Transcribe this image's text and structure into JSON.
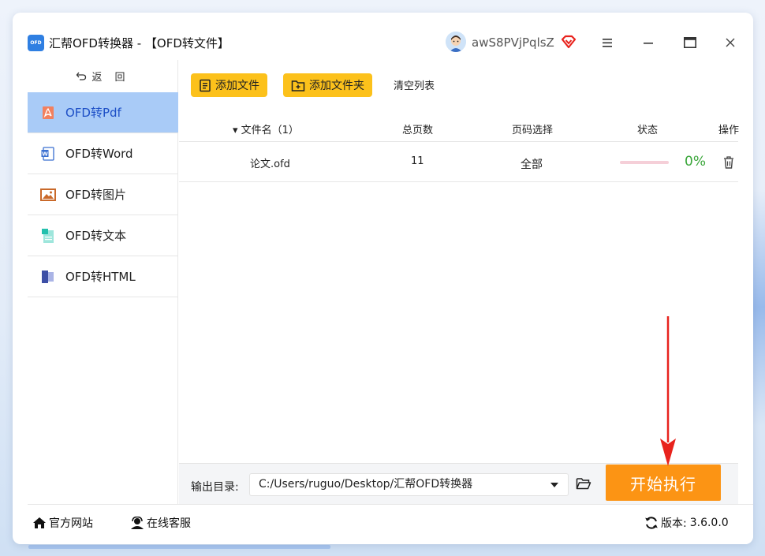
{
  "window": {
    "logo_text": "OFD",
    "title": "汇帮OFD转换器 - 【OFD转文件】",
    "username": "awS8PVjPqlsZ"
  },
  "sidebar": {
    "back_label": "返 回",
    "items": [
      {
        "label": "OFD转Pdf",
        "icon": "pdf-icon",
        "active": true
      },
      {
        "label": "OFD转Word",
        "icon": "word-icon",
        "active": false
      },
      {
        "label": "OFD转图片",
        "icon": "image-icon",
        "active": false
      },
      {
        "label": "OFD转文本",
        "icon": "text-icon",
        "active": false
      },
      {
        "label": "OFD转HTML",
        "icon": "html-icon",
        "active": false
      }
    ]
  },
  "toolbar": {
    "add_file": "添加文件",
    "add_folder": "添加文件夹",
    "clear_list": "清空列表"
  },
  "table": {
    "headers": {
      "filename": "▾ 文件名（1）",
      "pages": "总页数",
      "page_select": "页码选择",
      "status": "状态",
      "action": "操作"
    },
    "rows": [
      {
        "filename": "论文.ofd",
        "pages": "11",
        "page_select": "全部",
        "progress": 0,
        "percent": "0%"
      }
    ]
  },
  "output": {
    "label": "输出目录:",
    "path": "C:/Users/ruguo/Desktop/汇帮OFD转换器",
    "start_label": "开始执行"
  },
  "footer": {
    "website": "官方网站",
    "support": "在线客服",
    "version_label": "版本:",
    "version": "3.6.0.0"
  },
  "colors": {
    "accent": "#fcc11b",
    "start": "#fc9414",
    "active_nav": "#a9cbf7",
    "arrow": "#e8231d"
  }
}
